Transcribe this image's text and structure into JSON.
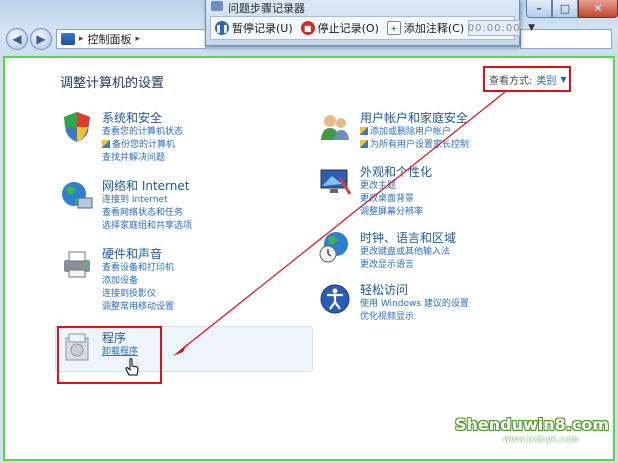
{
  "window": {
    "controls": [
      "–",
      "□",
      "✕"
    ]
  },
  "address": {
    "crumb": "控制面板",
    "sep": "▸"
  },
  "psr": {
    "title": "问题步骤记录器",
    "pause": "暂停记录(U)",
    "stop": "停止记录(O)",
    "add_comment": "添加注释(C)",
    "timer": "00:00:00"
  },
  "page": {
    "title": "调整计算机的设置",
    "view_by_label": "查看方式:",
    "view_by_value": "类别"
  },
  "categories": [
    {
      "title": "系统和安全",
      "links": [
        "查看您的计算机状态",
        "备份您的计算机",
        "查找并解决问题"
      ]
    },
    {
      "title": "网络和 Internet",
      "links": [
        "连接到 Internet",
        "查看网络状态和任务",
        "选择家庭组和共享选项"
      ]
    },
    {
      "title": "硬件和声音",
      "links": [
        "查看设备和打印机",
        "添加设备",
        "连接到投影仪",
        "调整常用移动设置"
      ]
    },
    {
      "title": "程序",
      "links": [
        "卸载程序"
      ]
    },
    {
      "title": "用户帐户和家庭安全",
      "links": [
        "添加或删除用户帐户",
        "为所有用户设置家长控制"
      ]
    },
    {
      "title": "外观和个性化",
      "links": [
        "更改主题",
        "更改桌面背景",
        "调整屏幕分辨率"
      ]
    },
    {
      "title": "时钟、语言和区域",
      "links": [
        "更改键盘或其他输入法",
        "更改显示语言"
      ]
    },
    {
      "title": "轻松访问",
      "links": [
        "使用 Windows 建议的设置",
        "优化视频显示"
      ]
    }
  ],
  "watermark": {
    "site": "Shenduwin8.com",
    "sub": "www.lxdnyk.com"
  },
  "colors": {
    "highlight_border": "#e0101a",
    "content_border": "#4fdc3c",
    "link": "#2a6fc9"
  }
}
